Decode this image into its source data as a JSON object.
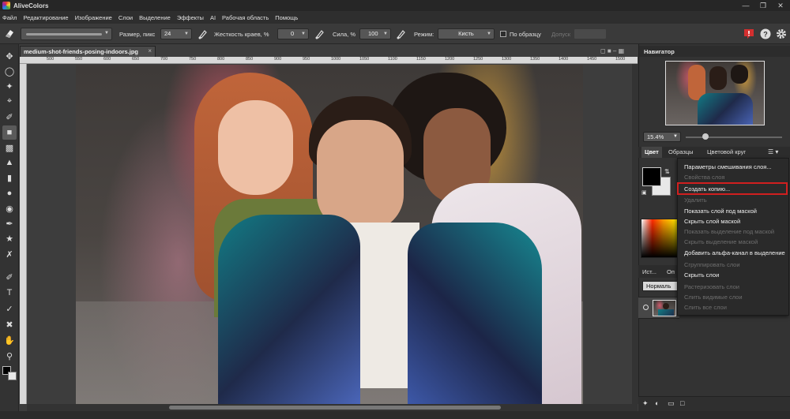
{
  "app": {
    "title": "AliveColors"
  },
  "menu": [
    "Файл",
    "Редактирование",
    "Изображение",
    "Слои",
    "Выделение",
    "Эффекты",
    "AI",
    "Рабочая область",
    "Помощь"
  ],
  "options": {
    "size_label": "Размер, пикс",
    "size_value": "24",
    "hardness_label": "Жесткость краев, %",
    "hardness_value": "0",
    "strength_label": "Сила, %",
    "strength_value": "100",
    "mode_label": "Режим:",
    "mode_value": "Кисть",
    "sample_label": "По образцу",
    "tolerance_label": "Допуск"
  },
  "document": {
    "tab_name": "medium-shot-friends-posing-indoors.jpg",
    "ruler_ticks": [
      "500",
      "550",
      "600",
      "650",
      "700",
      "750",
      "800",
      "850",
      "900",
      "950",
      "1000",
      "1050",
      "1100",
      "1150",
      "1200",
      "1250",
      "1300",
      "1350",
      "1400",
      "1450",
      "1500",
      "1550"
    ]
  },
  "navigator": {
    "title": "Навигатор",
    "zoom": "15.4%"
  },
  "color_panel": {
    "tabs": [
      "Цвет",
      "Образцы",
      "Цветовой круг"
    ],
    "fg_color": "#000000",
    "bg_color": "#e8e8e8"
  },
  "layers_panel": {
    "tabs": [
      "Ист...",
      "Оп"
    ],
    "blend_mode": "Нормаль"
  },
  "context_menu": {
    "items": [
      {
        "label": "Параметры смешивания слоя...",
        "enabled": true
      },
      {
        "label": "Свойства слоя",
        "enabled": false
      },
      {
        "label": "Создать копию...",
        "enabled": true,
        "highlighted": true
      },
      {
        "label": "Удалить",
        "enabled": false
      },
      {
        "label": "Показать слой под маской",
        "enabled": true
      },
      {
        "label": "Скрыть слой маской",
        "enabled": true
      },
      {
        "label": "Показать выделение под маской",
        "enabled": false
      },
      {
        "label": "Скрыть выделение маской",
        "enabled": false
      },
      {
        "label": "Добавить альфа-канал в выделение",
        "enabled": true
      },
      {
        "label": "Сгруппировать слои",
        "enabled": false
      },
      {
        "label": "Скрыть слои",
        "enabled": true
      },
      {
        "label": "Растеризовать слои",
        "enabled": false
      },
      {
        "label": "Слить видимые слои",
        "enabled": false
      },
      {
        "label": "Слить все слои",
        "enabled": false
      }
    ],
    "highlight_color": "#d01f1f"
  },
  "icons": {
    "toolbar": [
      "move-icon",
      "lasso-icon",
      "magic-wand-icon",
      "crop-icon",
      "brush-icon",
      "eraser-icon",
      "gradient-icon",
      "stamp-icon",
      "smudge-icon",
      "drop-icon",
      "dodge-icon",
      "pen-icon",
      "shapes-icon",
      "pipette-icon",
      "text-icon",
      "path-icon",
      "eyedropper-icon",
      "hand-icon",
      "zoom-icon"
    ]
  }
}
